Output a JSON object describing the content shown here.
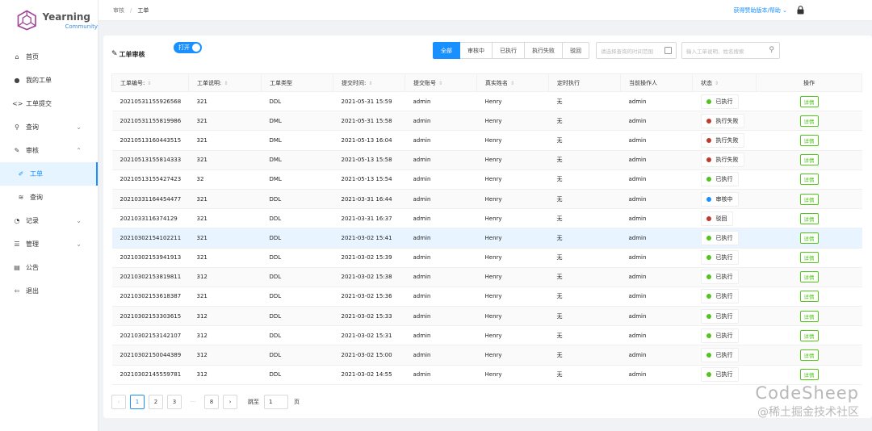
{
  "app": {
    "name": "Yearning",
    "sub": "Community"
  },
  "breadcrumb": {
    "root": "审核",
    "current": "工单"
  },
  "header": {
    "help_link": "获得赞助版本/帮助 ⌄"
  },
  "sidebar": {
    "items": [
      {
        "label": "首页",
        "icon": "home-icon",
        "glyph": "⌂"
      },
      {
        "label": "我的工单",
        "icon": "user-icon",
        "glyph": "●"
      },
      {
        "label": "工单提交",
        "icon": "code-icon",
        "glyph": "<>"
      },
      {
        "label": "查询",
        "icon": "search-icon",
        "glyph": "⚲"
      },
      {
        "label": "审核",
        "icon": "edit-icon",
        "glyph": "✎"
      },
      {
        "label": "工单",
        "icon": "pen-icon",
        "glyph": "✐"
      },
      {
        "label": "查询",
        "icon": "rss-icon",
        "glyph": "≋"
      },
      {
        "label": "记录",
        "icon": "pie-chart-icon",
        "glyph": "◔"
      },
      {
        "label": "管理",
        "icon": "stack-icon",
        "glyph": "☰"
      },
      {
        "label": "公告",
        "icon": "clipboard-icon",
        "glyph": "▤"
      },
      {
        "label": "退出",
        "icon": "logout-icon",
        "glyph": "⇦"
      }
    ]
  },
  "card": {
    "title": "工单审核",
    "toggle_label": "打开",
    "filters": [
      "全部",
      "审核中",
      "已执行",
      "执行失败",
      "驳回"
    ],
    "date_placeholder": "请选择查询的时间范围",
    "search_placeholder": "输入工单说明、姓名搜索"
  },
  "table": {
    "columns": [
      "工单编号:",
      "工单说明:",
      "工单类型",
      "提交时间:",
      "提交账号",
      "真实姓名",
      "定时执行",
      "当前操作人",
      "状态",
      "操作"
    ],
    "detail_label": "详情",
    "rows": [
      {
        "id": "20210531155926568",
        "desc": "321",
        "type": "DDL",
        "time": "2021-05-31 15:59",
        "account": "admin",
        "name": "Henry",
        "timer": "无",
        "operator": "admin",
        "status": "已执行",
        "status_color": "#52c41a"
      },
      {
        "id": "20210531155819986",
        "desc": "321",
        "type": "DML",
        "time": "2021-05-31 15:58",
        "account": "admin",
        "name": "Henry",
        "timer": "无",
        "operator": "admin",
        "status": "执行失败",
        "status_color": "#c0392b"
      },
      {
        "id": "20210513160443515",
        "desc": "321",
        "type": "DML",
        "time": "2021-05-13 16:04",
        "account": "admin",
        "name": "Henry",
        "timer": "无",
        "operator": "admin",
        "status": "执行失败",
        "status_color": "#c0392b"
      },
      {
        "id": "20210513155814333",
        "desc": "321",
        "type": "DML",
        "time": "2021-05-13 15:58",
        "account": "admin",
        "name": "Henry",
        "timer": "无",
        "operator": "admin",
        "status": "执行失败",
        "status_color": "#c0392b"
      },
      {
        "id": "20210513155427423",
        "desc": "32",
        "type": "DML",
        "time": "2021-05-13 15:54",
        "account": "admin",
        "name": "Henry",
        "timer": "无",
        "operator": "admin",
        "status": "已执行",
        "status_color": "#52c41a"
      },
      {
        "id": "20210331164454477",
        "desc": "321",
        "type": "DDL",
        "time": "2021-03-31 16:44",
        "account": "admin",
        "name": "Henry",
        "timer": "无",
        "operator": "admin",
        "status": "审核中",
        "status_color": "#1890ff"
      },
      {
        "id": "20210331163741​29",
        "desc": "321",
        "type": "DDL",
        "time": "2021-03-31 16:37",
        "account": "admin",
        "name": "Henry",
        "timer": "无",
        "operator": "admin",
        "status": "驳回",
        "status_color": "#c0392b"
      },
      {
        "id": "20210302154102211",
        "desc": "321",
        "type": "DDL",
        "time": "2021-03-02 15:41",
        "account": "admin",
        "name": "Henry",
        "timer": "无",
        "operator": "admin",
        "status": "已执行",
        "status_color": "#52c41a"
      },
      {
        "id": "20210302153941913",
        "desc": "321",
        "type": "DDL",
        "time": "2021-03-02 15:39",
        "account": "admin",
        "name": "Henry",
        "timer": "无",
        "operator": "admin",
        "status": "已执行",
        "status_color": "#52c41a"
      },
      {
        "id": "20210302153819811",
        "desc": "312",
        "type": "DDL",
        "time": "2021-03-02 15:38",
        "account": "admin",
        "name": "Henry",
        "timer": "无",
        "operator": "admin",
        "status": "已执行",
        "status_color": "#52c41a"
      },
      {
        "id": "20210302153618387",
        "desc": "321",
        "type": "DDL",
        "time": "2021-03-02 15:36",
        "account": "admin",
        "name": "Henry",
        "timer": "无",
        "operator": "admin",
        "status": "已执行",
        "status_color": "#52c41a"
      },
      {
        "id": "20210302153303615",
        "desc": "312",
        "type": "DDL",
        "time": "2021-03-02 15:33",
        "account": "admin",
        "name": "Henry",
        "timer": "无",
        "operator": "admin",
        "status": "已执行",
        "status_color": "#52c41a"
      },
      {
        "id": "20210302153142107",
        "desc": "312",
        "type": "DDL",
        "time": "2021-03-02 15:31",
        "account": "admin",
        "name": "Henry",
        "timer": "无",
        "operator": "admin",
        "status": "已执行",
        "status_color": "#52c41a"
      },
      {
        "id": "20210302150044389",
        "desc": "312",
        "type": "DDL",
        "time": "2021-03-02 15:00",
        "account": "admin",
        "name": "Henry",
        "timer": "无",
        "operator": "admin",
        "status": "已执行",
        "status_color": "#52c41a"
      },
      {
        "id": "20210302145559781",
        "desc": "312",
        "type": "DDL",
        "time": "2021-03-02 14:55",
        "account": "admin",
        "name": "Henry",
        "timer": "无",
        "operator": "admin",
        "status": "已执行",
        "status_color": "#52c41a"
      }
    ]
  },
  "pagination": {
    "prev": "‹",
    "pages": [
      "1",
      "2",
      "3"
    ],
    "ellipsis": "···",
    "last": "8",
    "next": "›",
    "current": "1",
    "jump_label": "跳至",
    "jump_value": "1",
    "jump_suffix": "页"
  },
  "watermark": {
    "line1": "CodeSheep",
    "line2": "@稀土掘金技术社区"
  },
  "colors": {
    "accent": "#1890ff",
    "success": "#52c41a",
    "danger": "#c0392b",
    "logo": "#a0449b"
  }
}
